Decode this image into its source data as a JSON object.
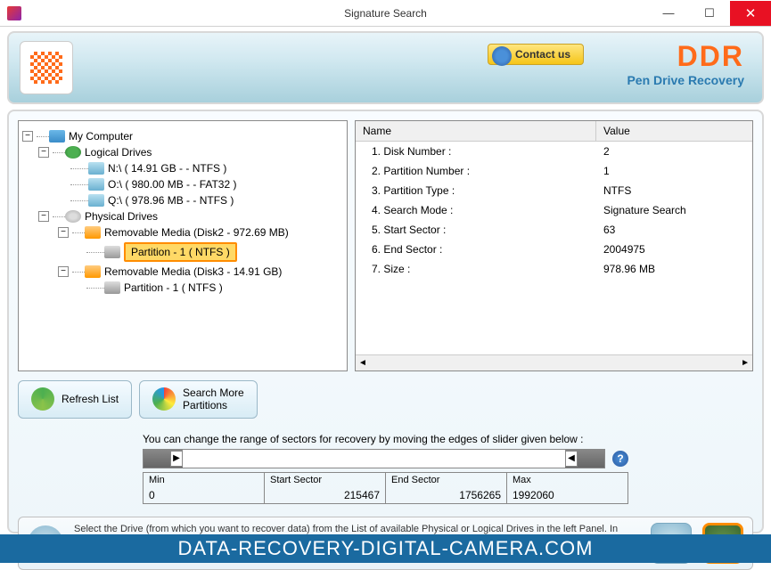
{
  "window": {
    "title": "Signature Search"
  },
  "header": {
    "contact_label": "Contact us",
    "brand": "DDR",
    "brand_sub": "Pen Drive Recovery"
  },
  "tree": {
    "root": "My Computer",
    "logical_label": "Logical Drives",
    "logical": [
      "N:\\ ( 14.91 GB  -  - NTFS )",
      "O:\\ ( 980.00 MB  -  - FAT32 )",
      "Q:\\ ( 978.96 MB  -  - NTFS )"
    ],
    "physical_label": "Physical Drives",
    "media1": "Removable Media  (Disk2 - 972.69 MB)",
    "media1_part": "Partition - 1 ( NTFS )",
    "media2": "Removable Media  (Disk3 - 14.91 GB)",
    "media2_part": "Partition - 1 ( NTFS )"
  },
  "details": {
    "col_name": "Name",
    "col_value": "Value",
    "rows": [
      {
        "name": "1. Disk Number :",
        "value": "2"
      },
      {
        "name": "2. Partition Number :",
        "value": "1"
      },
      {
        "name": "3. Partition Type :",
        "value": "NTFS"
      },
      {
        "name": "4. Search Mode :",
        "value": "Signature Search"
      },
      {
        "name": "5. Start Sector :",
        "value": "63"
      },
      {
        "name": "6. End Sector :",
        "value": "2004975"
      },
      {
        "name": "7. Size :",
        "value": "978.96 MB"
      }
    ]
  },
  "buttons": {
    "refresh": "Refresh List",
    "search_more": "Search More\nPartitions"
  },
  "sector": {
    "hint": "You can change the range of sectors for recovery by moving the edges of slider given below :",
    "min_label": "Min",
    "min": "0",
    "start_label": "Start Sector",
    "start": "215467",
    "end_label": "End Sector",
    "end": "1756265",
    "max_label": "Max",
    "max": "1992060"
  },
  "footer": {
    "text": "Select the Drive (from which you want to recover data) from the List of available Physical or Logical Drives in the left Panel. In case of Deleted or missing Partitions, click on 'Search More Partitions' button to find lost drives. Select the Drive and click 'Next' Button to continue..."
  },
  "watermark": "DATA-RECOVERY-DIGITAL-CAMERA.COM"
}
